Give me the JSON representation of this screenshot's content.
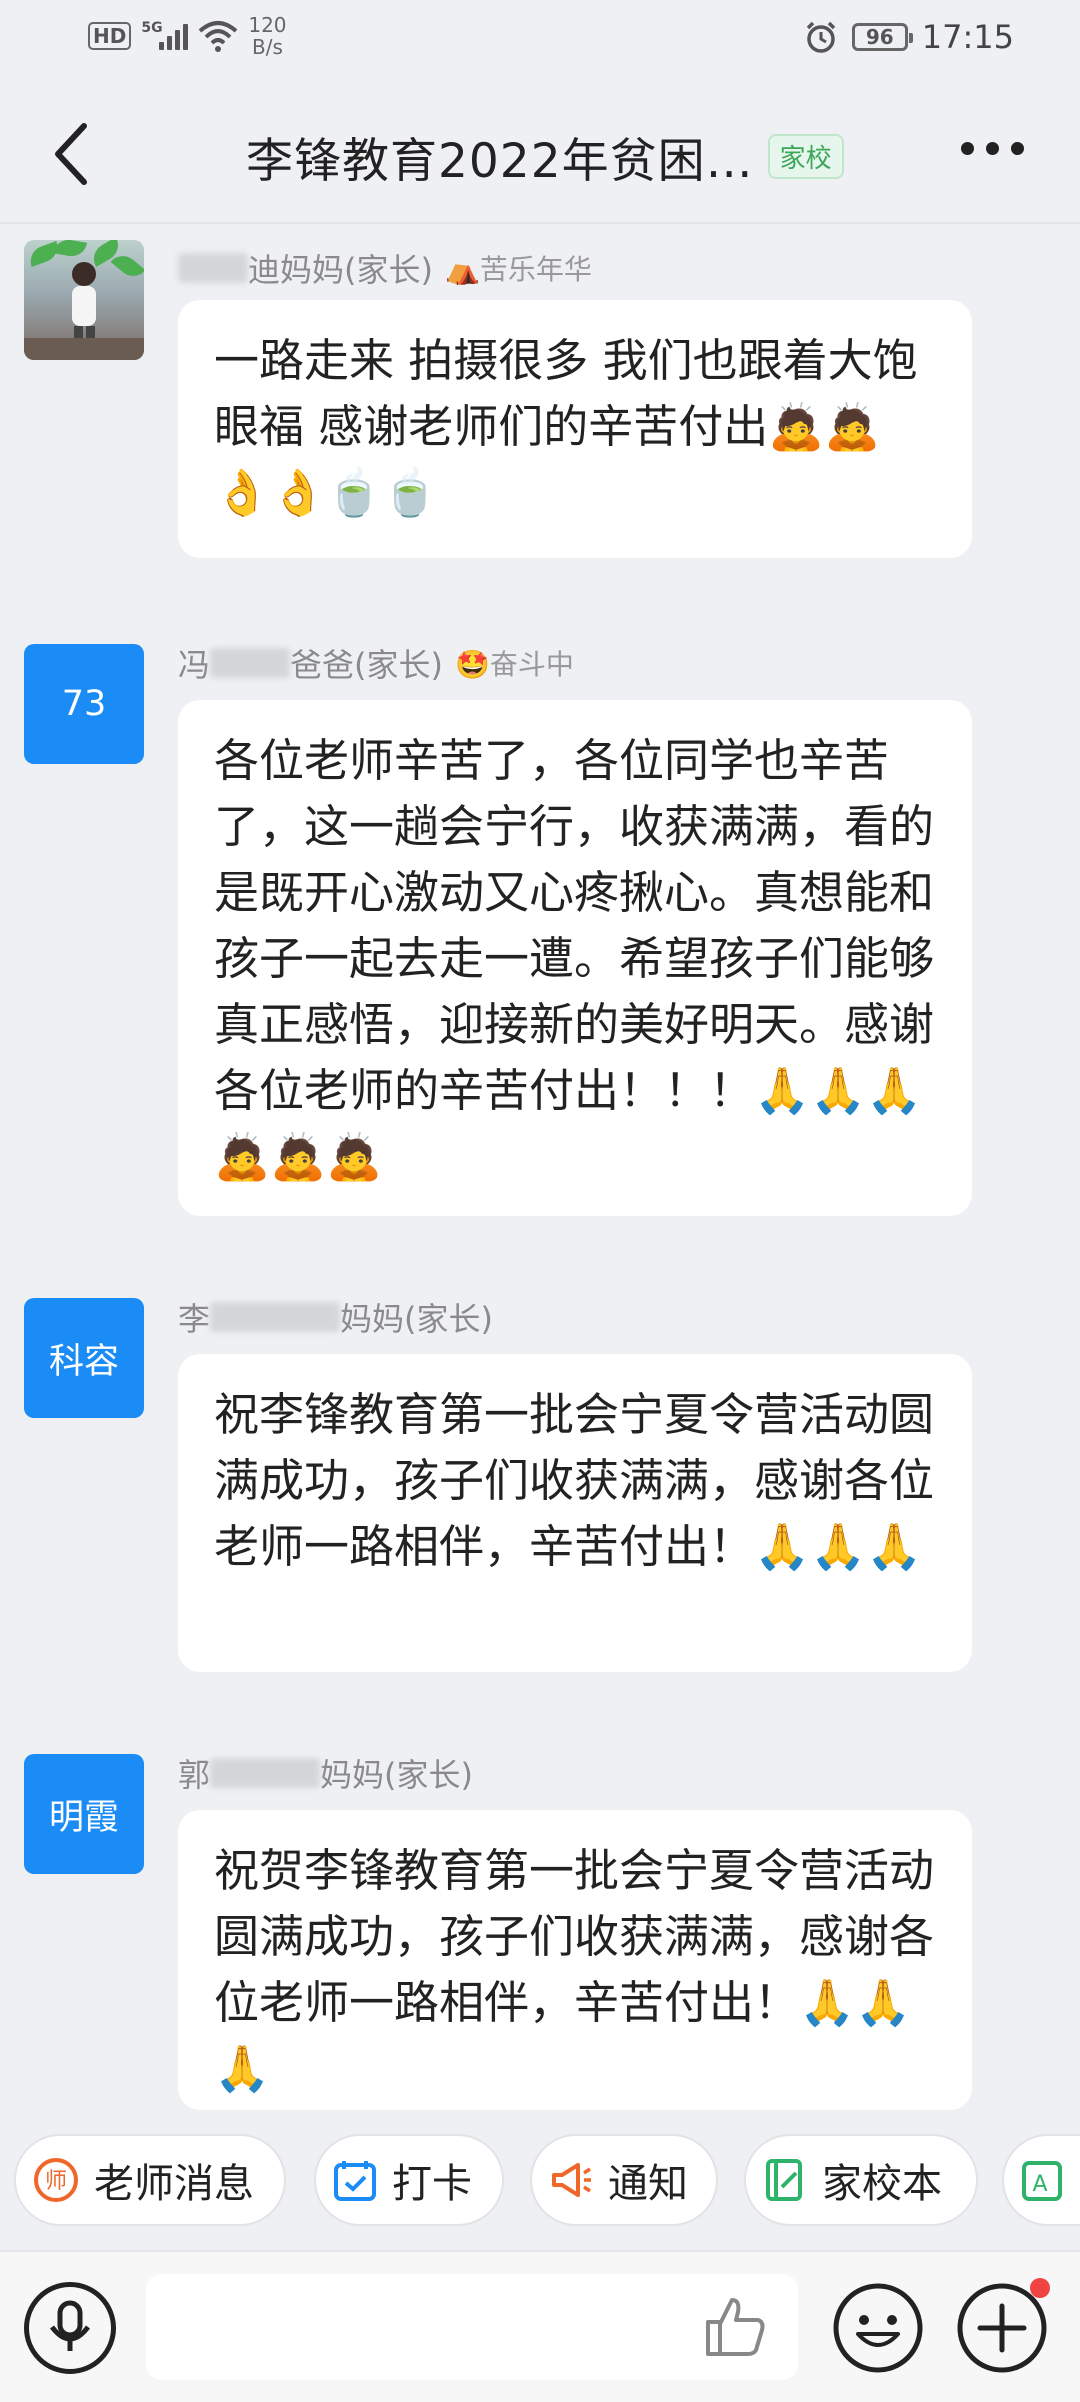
{
  "status_bar": {
    "hd": "HD",
    "network": "5G",
    "speed_value": "120",
    "speed_unit": "B/s",
    "battery": "96",
    "time": "17:15"
  },
  "header": {
    "title": "李锋教育2022年贫困…",
    "tag": "家校"
  },
  "messages": [
    {
      "avatar_text": "",
      "sender_visible": "迪妈妈(家长)",
      "badge": "⛺苦乐年华",
      "text": "一路走来 拍摄很多 我们也跟着大饱眼福 感谢老师们的辛苦付出🙇🙇👌👌🍵🍵"
    },
    {
      "avatar_text": "73",
      "sender_prefix": "冯",
      "sender_visible": "爸爸(家长)",
      "badge": "🤩奋斗中",
      "text": "各位老师辛苦了，各位同学也辛苦了，这一趟会宁行，收获满满，看的是既开心激动又心疼揪心。真想能和孩子一起去走一遭。希望孩子们能够真正感悟，迎接新的美好明天。感谢各位老师的辛苦付出！！！🙏🙏🙏🙇🙇🙇"
    },
    {
      "avatar_text": "科容",
      "sender_prefix": "李",
      "sender_visible": "妈妈(家长)",
      "badge": "",
      "text": "祝李锋教育第一批会宁夏令营活动圆满成功，孩子们收获满满，感谢各位老师一路相伴，辛苦付出！🙏🙏🙏"
    },
    {
      "avatar_text": "明霞",
      "sender_prefix": "郭",
      "sender_visible": "妈妈(家长)",
      "badge": "",
      "text": "祝贺李锋教育第一批会宁夏令营活动圆满成功，孩子们收获满满，感谢各位老师一路相伴，辛苦付出！🙏🙏🙏"
    }
  ],
  "shortcuts": [
    {
      "label": "老师消息",
      "icon": "teacher-icon",
      "color": "#f0672a"
    },
    {
      "label": "打卡",
      "icon": "checkin-icon",
      "color": "#1b8cf5"
    },
    {
      "label": "通知",
      "icon": "megaphone-icon",
      "color": "#f0672a"
    },
    {
      "label": "家校本",
      "icon": "notebook-icon",
      "color": "#2fb36b"
    },
    {
      "label": "",
      "icon": "ai-icon",
      "color": "#2fb36b"
    }
  ],
  "input": {
    "placeholder": ""
  }
}
